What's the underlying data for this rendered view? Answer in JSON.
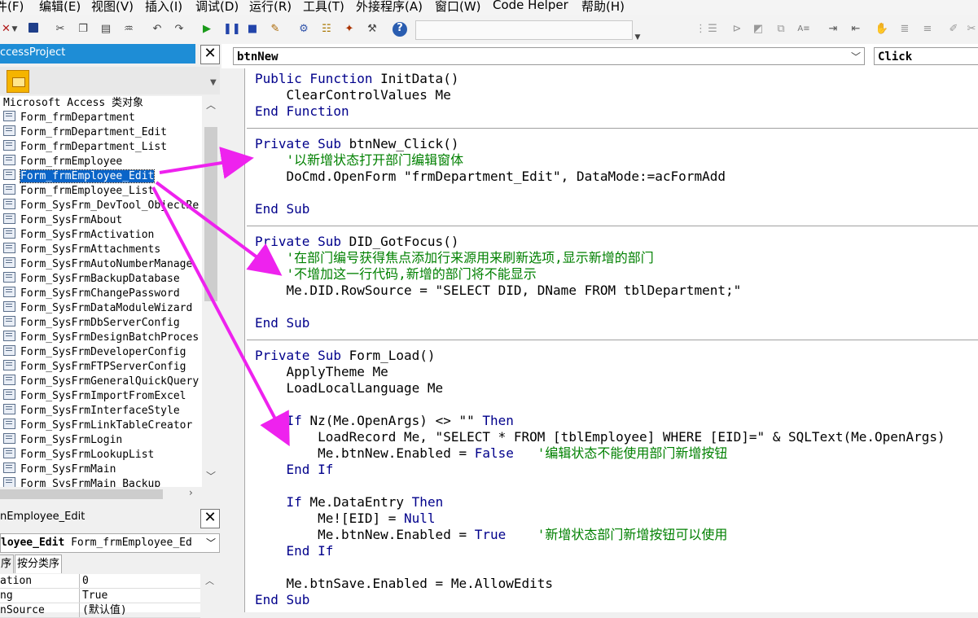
{
  "menubar": {
    "items": [
      "件(F)",
      "编辑(E)",
      "视图(V)",
      "插入(I)",
      "调试(D)",
      "运行(R)",
      "工具(T)",
      "外接程序(A)",
      "窗口(W)",
      "Code Helper",
      "帮助(H)"
    ]
  },
  "toolbar": {
    "icons": [
      "access-view-icon",
      "dropdown-arrow-icon",
      "save-icon",
      "cut-icon",
      "copy-icon",
      "paste-icon",
      "find-icon",
      "undo-icon",
      "redo-icon",
      "run-icon",
      "break-icon",
      "reset-icon",
      "design-mode-icon",
      "project-explorer-icon",
      "properties-icon",
      "object-browser-icon",
      "toolbox-icon",
      "help-icon"
    ]
  },
  "project": {
    "title": "ccessProject",
    "root_label": "Microsoft Access 类对象",
    "items": [
      "Form_frmDepartment",
      "Form_frmDepartment_Edit",
      "Form_frmDepartment_List",
      "Form_frmEmployee",
      "Form_frmEmployee_Edit",
      "Form_frmEmployee_List",
      "Form_SysFrm_DevTool_ObjectRe",
      "Form_SysFrmAbout",
      "Form_SysFrmActivation",
      "Form_SysFrmAttachments",
      "Form_SysFrmAutoNumberManage",
      "Form_SysFrmBackupDatabase",
      "Form_SysFrmChangePassword",
      "Form_SysFrmDataModuleWizard",
      "Form_SysFrmDbServerConfig",
      "Form_SysFrmDesignBatchProces",
      "Form_SysFrmDeveloperConfig",
      "Form_SysFrmFTPServerConfig",
      "Form_SysFrmGeneralQuickQuery",
      "Form_SysFrmImportFromExcel",
      "Form_SysFrmInterfaceStyle",
      "Form_SysFrmLinkTableCreator",
      "Form_SysFrmLogin",
      "Form_SysFrmLookupList",
      "Form_SysFrmMain",
      "Form_SysFrmMain_Backup"
    ],
    "selected_index": 4
  },
  "properties": {
    "title": "nEmployee_Edit",
    "object_bold": "loyee_Edit",
    "object_rest": "Form_frmEmployee_Ed",
    "tabs": [
      "序",
      "按分类序"
    ],
    "rows": [
      {
        "key": "ation",
        "value": "0"
      },
      {
        "key": "ng",
        "value": "True"
      },
      {
        "key": "nSource",
        "value": "(默认值)"
      }
    ]
  },
  "code": {
    "object": "btnNew",
    "procedure": "Click",
    "lines": [
      [
        {
          "t": "Public Function ",
          "k": "kw"
        },
        {
          "t": "InitData()"
        }
      ],
      [
        {
          "t": "    ClearControlValues Me"
        }
      ],
      [
        {
          "t": "End Function",
          "k": "kw"
        }
      ],
      [],
      [
        {
          "t": "Private Sub ",
          "k": "kw"
        },
        {
          "t": "btnNew_Click()"
        }
      ],
      [
        {
          "t": "    '以新增状态打开部门编辑窗体",
          "k": "cm"
        }
      ],
      [
        {
          "t": "    DoCmd.OpenForm \"frmDepartment_Edit\", DataMode:=acFormAdd"
        }
      ],
      [],
      [
        {
          "t": "End Sub",
          "k": "kw"
        }
      ],
      [],
      [
        {
          "t": "Private Sub ",
          "k": "kw"
        },
        {
          "t": "DID_GotFocus()"
        }
      ],
      [
        {
          "t": "    '在部门编号获得焦点添加行来源用来刷新选项,显示新增的部门",
          "k": "cm"
        }
      ],
      [
        {
          "t": "    '不增加这一行代码,新增的部门将不能显示",
          "k": "cm"
        }
      ],
      [
        {
          "t": "    Me.DID.RowSource = \"SELECT DID, DName FROM tblDepartment;\""
        }
      ],
      [],
      [
        {
          "t": "End Sub",
          "k": "kw"
        }
      ],
      [],
      [
        {
          "t": "Private Sub ",
          "k": "kw"
        },
        {
          "t": "Form_Load()"
        }
      ],
      [
        {
          "t": "    ApplyTheme Me"
        }
      ],
      [
        {
          "t": "    LoadLocalLanguage Me"
        }
      ],
      [],
      [
        {
          "t": "    If ",
          "k": "kw"
        },
        {
          "t": "Nz(Me.OpenArgs) <> \"\" "
        },
        {
          "t": "Then",
          "k": "kw"
        }
      ],
      [
        {
          "t": "        LoadRecord Me, \"SELECT * FROM [tblEmployee] WHERE [EID]=\" & SQLText(Me.OpenArgs)"
        }
      ],
      [
        {
          "t": "        Me.btnNew.Enabled = "
        },
        {
          "t": "False",
          "k": "kw"
        },
        {
          "t": "   "
        },
        {
          "t": "'编辑状态不能使用部门新增按钮",
          "k": "cm"
        }
      ],
      [
        {
          "t": "    End If",
          "k": "kw"
        }
      ],
      [],
      [
        {
          "t": "    If ",
          "k": "kw"
        },
        {
          "t": "Me.DataEntry "
        },
        {
          "t": "Then",
          "k": "kw"
        }
      ],
      [
        {
          "t": "        Me![EID] = "
        },
        {
          "t": "Null",
          "k": "kw"
        }
      ],
      [
        {
          "t": "        Me.btnNew.Enabled = "
        },
        {
          "t": "True",
          "k": "kw"
        },
        {
          "t": "    "
        },
        {
          "t": "'新增状态部门新增按钮可以使用",
          "k": "cm"
        }
      ],
      [
        {
          "t": "    End If",
          "k": "kw"
        }
      ],
      [],
      [
        {
          "t": "    Me.btnSave.Enabled = Me.AllowEdits"
        }
      ],
      [
        {
          "t": "End Sub",
          "k": "kw"
        }
      ]
    ]
  },
  "colors": {
    "keyword": "#00008b",
    "comment": "#008000",
    "arrow": "#ee22ee",
    "selection": "#0a64c8",
    "title_bar": "#1e8dd6"
  }
}
